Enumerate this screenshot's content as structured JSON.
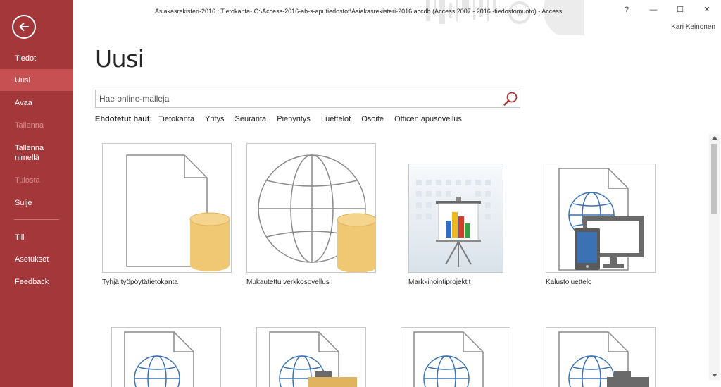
{
  "window": {
    "title": "Asiakasrekisteri-2016 : Tietokanta- C:\\Access-2016-ab-s-aputiedostot\\Asiakasrekisteri-2016.accdb (Access 2007 - 2016 -tiedostomuoto) - Access",
    "help_label": "?",
    "minimize_label": "—",
    "maximize_label": "☐",
    "close_label": "✕",
    "user_name": "Kari Keinonen"
  },
  "sidebar": {
    "back_icon": "back-arrow-icon",
    "items": [
      {
        "label": "Tiedot",
        "enabled": true,
        "selected": false
      },
      {
        "label": "Uusi",
        "enabled": true,
        "selected": true
      },
      {
        "label": "Avaa",
        "enabled": true,
        "selected": false
      },
      {
        "label": "Tallenna",
        "enabled": false,
        "selected": false
      },
      {
        "label": "Tallenna nimellä",
        "enabled": true,
        "selected": false
      },
      {
        "label": "Tulosta",
        "enabled": false,
        "selected": false
      },
      {
        "label": "Sulje",
        "enabled": true,
        "selected": false
      },
      {
        "label": "Tili",
        "enabled": true,
        "selected": false
      },
      {
        "label": "Asetukset",
        "enabled": true,
        "selected": false
      },
      {
        "label": "Feedback",
        "enabled": true,
        "selected": false
      }
    ]
  },
  "main": {
    "title": "Uusi",
    "search": {
      "placeholder": "Hae online-malleja",
      "value": ""
    },
    "suggestions": {
      "label": "Ehdotetut haut:",
      "items": [
        "Tietokanta",
        "Yritys",
        "Seuranta",
        "Pienyritys",
        "Luettelot",
        "Osoite",
        "Officen apusovellus"
      ]
    },
    "templates": [
      {
        "label": "Tyhjä työpöytätietokanta",
        "icon": "blank-database-icon"
      },
      {
        "label": "Mukautettu verkkosovellus",
        "icon": "custom-web-app-icon"
      },
      {
        "label": "Markkinointiprojektit",
        "icon": "marketing-projects-icon"
      },
      {
        "label": "Kalustoluettelo",
        "icon": "asset-tracking-icon"
      }
    ]
  },
  "colors": {
    "accent": "#a4373a",
    "accent_selected": "#c75052",
    "database_yellow": "#f0c874"
  }
}
